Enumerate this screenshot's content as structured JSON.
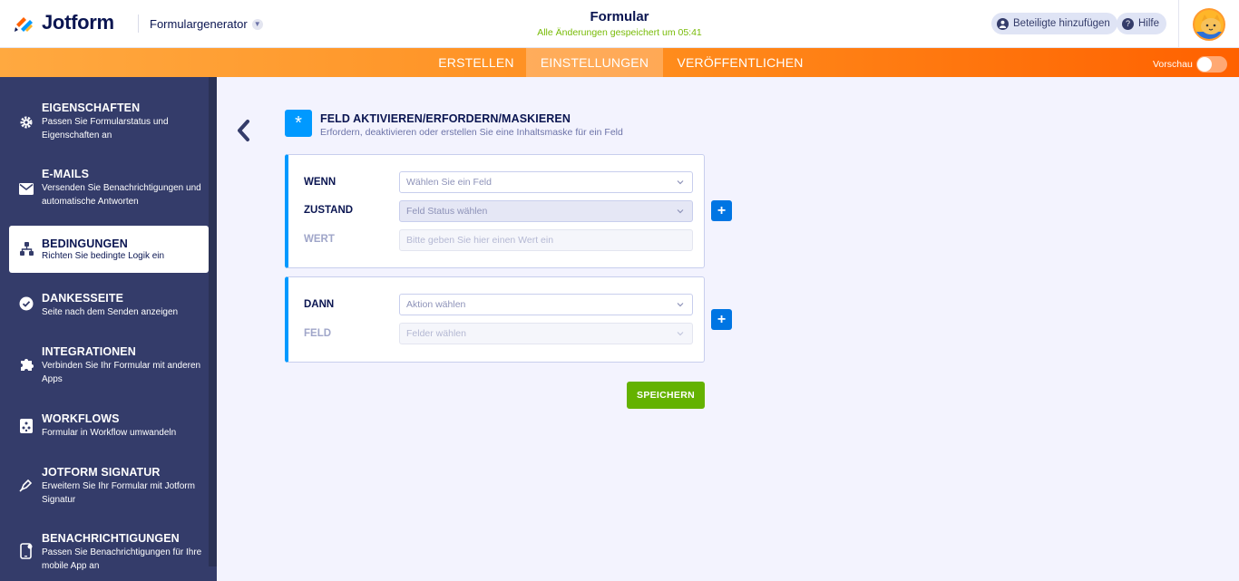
{
  "header": {
    "logo_text": "Jotform",
    "app_switcher_label": "Formulargenerator",
    "form_title": "Formular",
    "save_status": "Alle Änderungen gespeichert um 05:41",
    "add_participants_label": "Beteiligte hinzufügen",
    "help_label": "Hilfe"
  },
  "nav": {
    "tabs": [
      {
        "label": "ERSTELLEN"
      },
      {
        "label": "EINSTELLUNGEN"
      },
      {
        "label": "VERÖFFENTLICHEN"
      }
    ],
    "active_tab": "EINSTELLUNGEN",
    "preview_label": "Vorschau"
  },
  "sidebar": {
    "items": [
      {
        "title": "EIGENSCHAFTEN",
        "desc": "Passen Sie Formularstatus und Eigenschaften an",
        "icon": "gear-icon"
      },
      {
        "title": "E-MAILS",
        "desc": "Versenden Sie Benachrichtigungen und automatische Antworten",
        "icon": "envelope-icon"
      },
      {
        "title": "BEDINGUNGEN",
        "desc": "Richten Sie bedingte Logik ein",
        "icon": "sitemap-icon"
      },
      {
        "title": "DANKESSEITE",
        "desc": "Seite nach dem Senden anzeigen",
        "icon": "check-circle-icon"
      },
      {
        "title": "INTEGRATIONEN",
        "desc": "Verbinden Sie Ihr Formular mit anderen Apps",
        "icon": "puzzle-icon"
      },
      {
        "title": "WORKFLOWS",
        "desc": "Formular in Workflow umwandeln",
        "icon": "workflow-icon"
      },
      {
        "title": "JOTFORM SIGNATUR",
        "desc": "Erweitern Sie Ihr Formular mit Jotform Signatur",
        "icon": "pen-icon"
      },
      {
        "title": "BENACHRICHTIGUNGEN",
        "desc": "Passen Sie Benachrichtigungen für Ihre mobile App an",
        "icon": "mobile-icon"
      }
    ],
    "active_item": "BEDINGUNGEN"
  },
  "condition": {
    "title": "FELD AKTIVIEREN/ERFORDERN/MASKIEREN",
    "description": "Erfordern, deaktivieren oder erstellen Sie eine Inhaltsmaske für ein Feld",
    "if_block": {
      "wenn_label": "WENN",
      "wenn_placeholder": "Wählen Sie ein Feld",
      "zustand_label": "ZUSTAND",
      "zustand_placeholder": "Feld Status wählen",
      "wert_label": "WERT",
      "wert_placeholder": "Bitte geben Sie hier einen Wert ein"
    },
    "then_block": {
      "dann_label": "DANN",
      "dann_placeholder": "Aktion wählen",
      "feld_label": "FELD",
      "feld_placeholder": "Felder wählen"
    },
    "add_symbol": "+",
    "save_label": "SPEICHERN"
  },
  "colors": {
    "sidebar_bg": "#343c6a",
    "accent_blue": "#0099ff",
    "save_green": "#64b200",
    "nav_orange": "#ff8b1c",
    "status_green": "#78bb07"
  }
}
